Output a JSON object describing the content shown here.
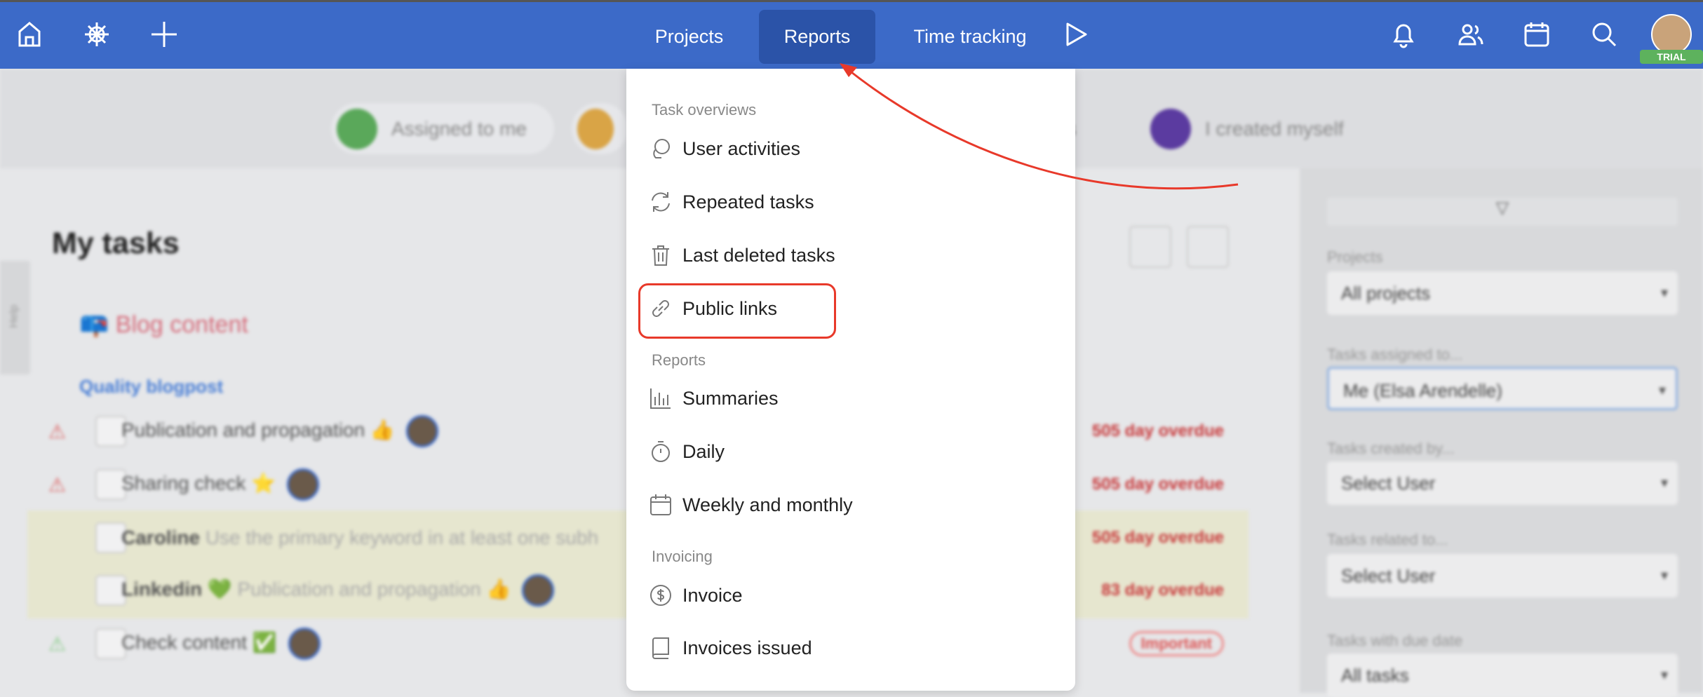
{
  "topbar": {
    "nav": [
      {
        "label": "Projects"
      },
      {
        "label": "Reports",
        "active": true
      },
      {
        "label": "Time tracking"
      }
    ],
    "left_icons": [
      "home-icon",
      "helm-icon",
      "plus-icon"
    ],
    "right_icons": [
      "bell-icon",
      "users-icon",
      "calendar-icon",
      "search-icon"
    ],
    "trial_badge": "TRIAL",
    "accent": "#3c6ac8"
  },
  "filters": {
    "chips": [
      {
        "label": "Assigned to me",
        "color": "#5aa85a"
      },
      {
        "label": "",
        "color": "#d9a446"
      },
      {
        "label": "hers",
        "color": ""
      },
      {
        "label": "I created myself",
        "color": "#5b3ba0"
      }
    ]
  },
  "main": {
    "title": "My tasks",
    "help_tab": "Help",
    "project": "Blog content",
    "section": "Quality blogpost",
    "rows": [
      {
        "text": "Publication and propagation 👍",
        "warn": "red",
        "due": "505 day overdue"
      },
      {
        "text": "Sharing check ⭐",
        "warn": "red",
        "due": "505 day overdue"
      },
      {
        "text": "Caroline",
        "sub": "Use the primary keyword in at least one subh",
        "due": "505 day overdue",
        "highlight": true
      },
      {
        "text": "Linkedin 💚",
        "sub": "Publication and propagation 👍",
        "due": "83 day overdue",
        "highlight": true
      },
      {
        "text": "Check content ✅",
        "warn": "green",
        "badge": "Important"
      }
    ]
  },
  "sidebar": {
    "fields": [
      {
        "label": "Projects",
        "value": "All projects"
      },
      {
        "label": "Tasks assigned to...",
        "value": "Me (Elsa Arendelle)"
      },
      {
        "label": "Tasks created by...",
        "value": "Select User"
      },
      {
        "label": "Tasks related to...",
        "value": "Select User"
      },
      {
        "label": "Tasks with due date",
        "value": "All tasks"
      }
    ]
  },
  "menu": {
    "sections": [
      {
        "header": "Task overviews",
        "items": [
          {
            "label": "User activities",
            "icon": "chat-icon"
          },
          {
            "label": "Repeated tasks",
            "icon": "refresh-icon"
          },
          {
            "label": "Last deleted tasks",
            "icon": "trash-icon"
          },
          {
            "label": "Public links",
            "icon": "link-icon",
            "highlighted": true
          }
        ]
      },
      {
        "header": "Reports",
        "items": [
          {
            "label": "Summaries",
            "icon": "bar-chart-icon"
          },
          {
            "label": "Daily",
            "icon": "stopwatch-icon"
          },
          {
            "label": "Weekly and monthly",
            "icon": "calendar-icon"
          }
        ]
      },
      {
        "header": "Invoicing",
        "items": [
          {
            "label": "Invoice",
            "icon": "dollar-icon"
          },
          {
            "label": "Invoices issued",
            "icon": "book-icon"
          }
        ]
      }
    ]
  },
  "annotation": {
    "color": "#e8392a"
  }
}
